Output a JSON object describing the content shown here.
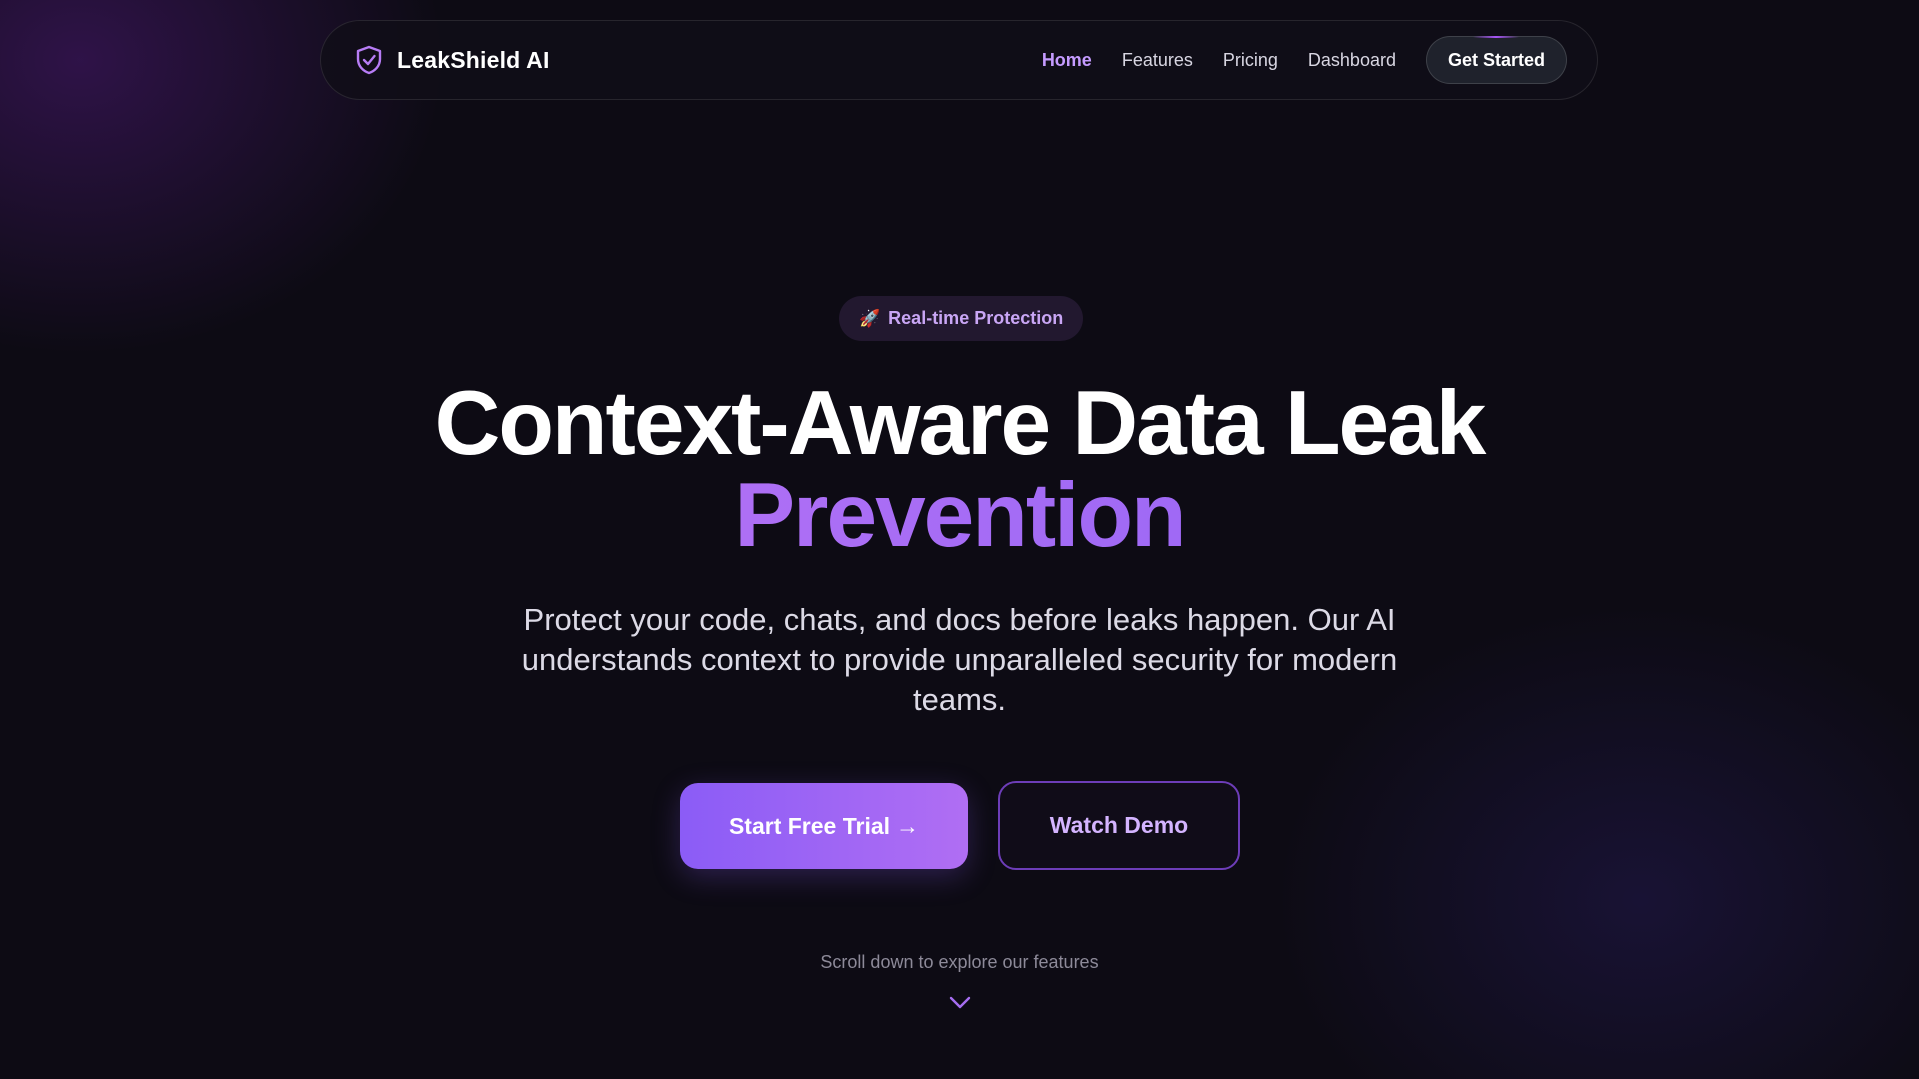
{
  "colors": {
    "background": "#0d0b14",
    "accent": "#a855f7",
    "accent_light": "#c59bff",
    "primary_gradient_start": "#8b5cf6",
    "primary_gradient_end": "#b06ef3"
  },
  "nav": {
    "brand_icon": "shield-check-icon",
    "brand_name": "LeakShield AI",
    "links": [
      {
        "label": "Home",
        "active": true
      },
      {
        "label": "Features",
        "active": false
      },
      {
        "label": "Pricing",
        "active": false
      },
      {
        "label": "Dashboard",
        "active": false
      }
    ],
    "cta_label": "Get Started"
  },
  "hero": {
    "badge_icon": "🚀",
    "badge_text": "Real-time Protection",
    "headline_line1": "Context-Aware Data Leak",
    "headline_line2": "Prevention",
    "subtitle": "Protect your code, chats, and docs before leaks happen. Our AI understands context to provide unparalleled security for modern teams.",
    "primary_button_label": "Start Free Trial",
    "primary_button_arrow": "→",
    "secondary_button_label": "Watch Demo",
    "scroll_hint": "Scroll down to explore our features",
    "scroll_icon": "chevron-down-icon"
  }
}
